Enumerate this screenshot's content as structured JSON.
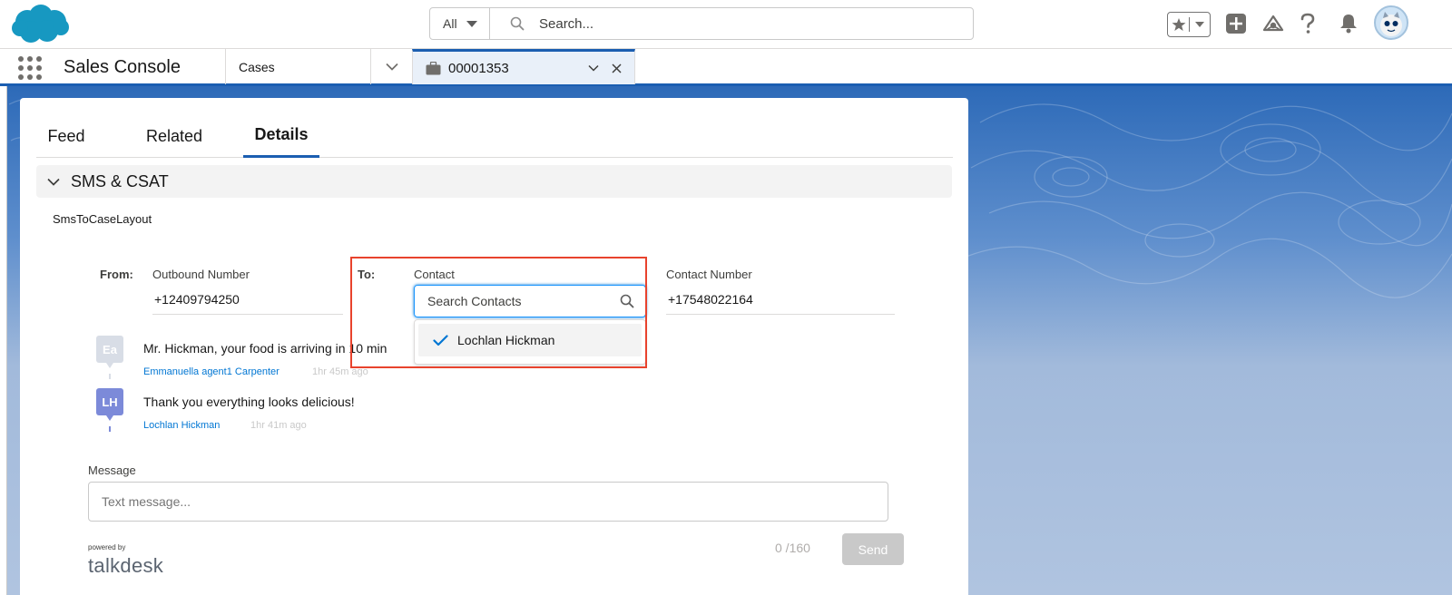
{
  "global_header": {
    "search_scope": "All",
    "search_placeholder": "Search...",
    "icons": [
      "favorites-star-icon",
      "add-icon",
      "trailhead-icon",
      "help-icon",
      "notifications-bell-icon",
      "user-avatar"
    ]
  },
  "app_nav": {
    "app_name": "Sales Console",
    "nav_item": "Cases",
    "active_tab": "00001353"
  },
  "record": {
    "tabs": [
      {
        "label": "Feed"
      },
      {
        "label": "Related"
      },
      {
        "label": "Details"
      }
    ],
    "active_tab": "Details",
    "section_title": "SMS & CSAT",
    "layout_name": "SmsToCaseLayout"
  },
  "sms": {
    "from_label": "From:",
    "outbound_label": "Outbound Number",
    "outbound_value": "+12409794250",
    "to_label": "To:",
    "contact_label": "Contact",
    "contact_placeholder": "Search Contacts",
    "contact_option": "Lochlan Hickman",
    "contact_number_label": "Contact Number",
    "contact_number_value": "+17548022164",
    "messages": [
      {
        "initials": "Ea",
        "text": "Mr. Hickman, your food is arriving in 10 min",
        "author": "Emmanuella agent1 Carpenter",
        "time": "1hr 45m ago"
      },
      {
        "initials": "LH",
        "text": "Thank you everything looks delicious!",
        "author": "Lochlan Hickman",
        "time": "1hr 41m ago"
      }
    ],
    "message_label": "Message",
    "message_placeholder": "Text message...",
    "counter": "0 /160",
    "send_label": "Send",
    "powered_by": "powered by",
    "brand": "talkdesk"
  },
  "colors": {
    "brand_blue": "#1b5eb1",
    "link_blue": "#0176d3",
    "highlight_red": "#e8432d",
    "lh_avatar": "#7c8ad9"
  }
}
